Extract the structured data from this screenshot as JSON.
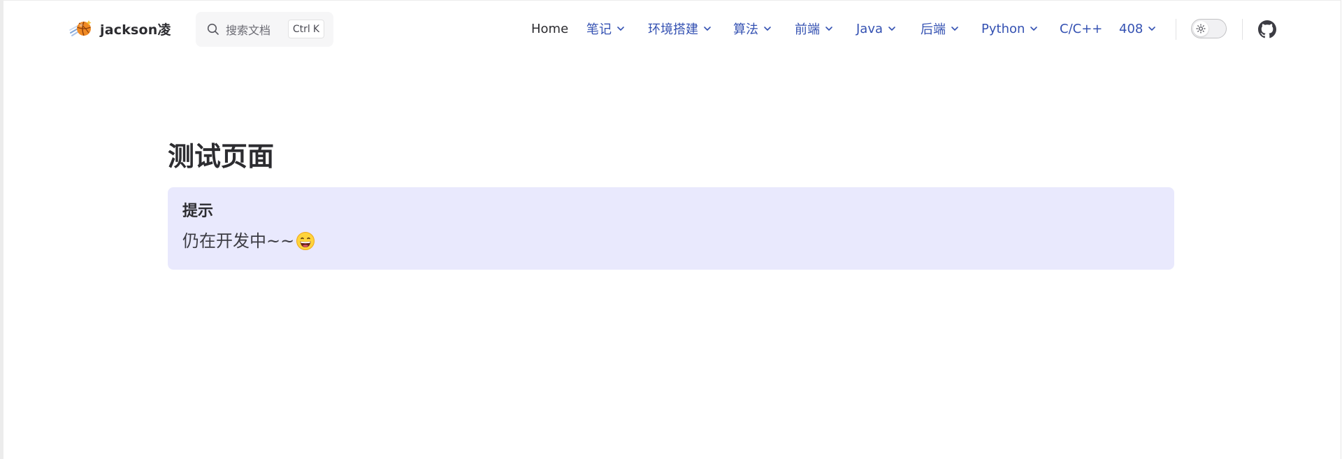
{
  "brand": {
    "title": "jackson凌"
  },
  "search": {
    "placeholder": "搜索文档",
    "kbd_mod": "Ctrl",
    "kbd_key": "K"
  },
  "nav": {
    "items": [
      {
        "label": "Home",
        "dropdown": false
      },
      {
        "label": "笔记",
        "dropdown": true
      },
      {
        "label": "环境搭建",
        "dropdown": true
      },
      {
        "label": "算法",
        "dropdown": true
      },
      {
        "label": "前端",
        "dropdown": true
      },
      {
        "label": "Java",
        "dropdown": true
      },
      {
        "label": "后端",
        "dropdown": true
      },
      {
        "label": "Python",
        "dropdown": true
      },
      {
        "label": "C/C++",
        "dropdown": false
      },
      {
        "label": "408",
        "dropdown": true
      }
    ]
  },
  "appearance": {
    "icon": "sun-icon",
    "dark_mode": false
  },
  "social": {
    "icon": "github-icon"
  },
  "page": {
    "title": "测试页面",
    "tip": {
      "title": "提示",
      "body": "仍在开发中~~",
      "emoji": "grinning-face-emoji"
    }
  },
  "colors": {
    "nav_link": "#3451b2",
    "text_primary": "#2c2c30",
    "tip_background": "#e9e9fd",
    "search_background": "#f6f6f7"
  }
}
